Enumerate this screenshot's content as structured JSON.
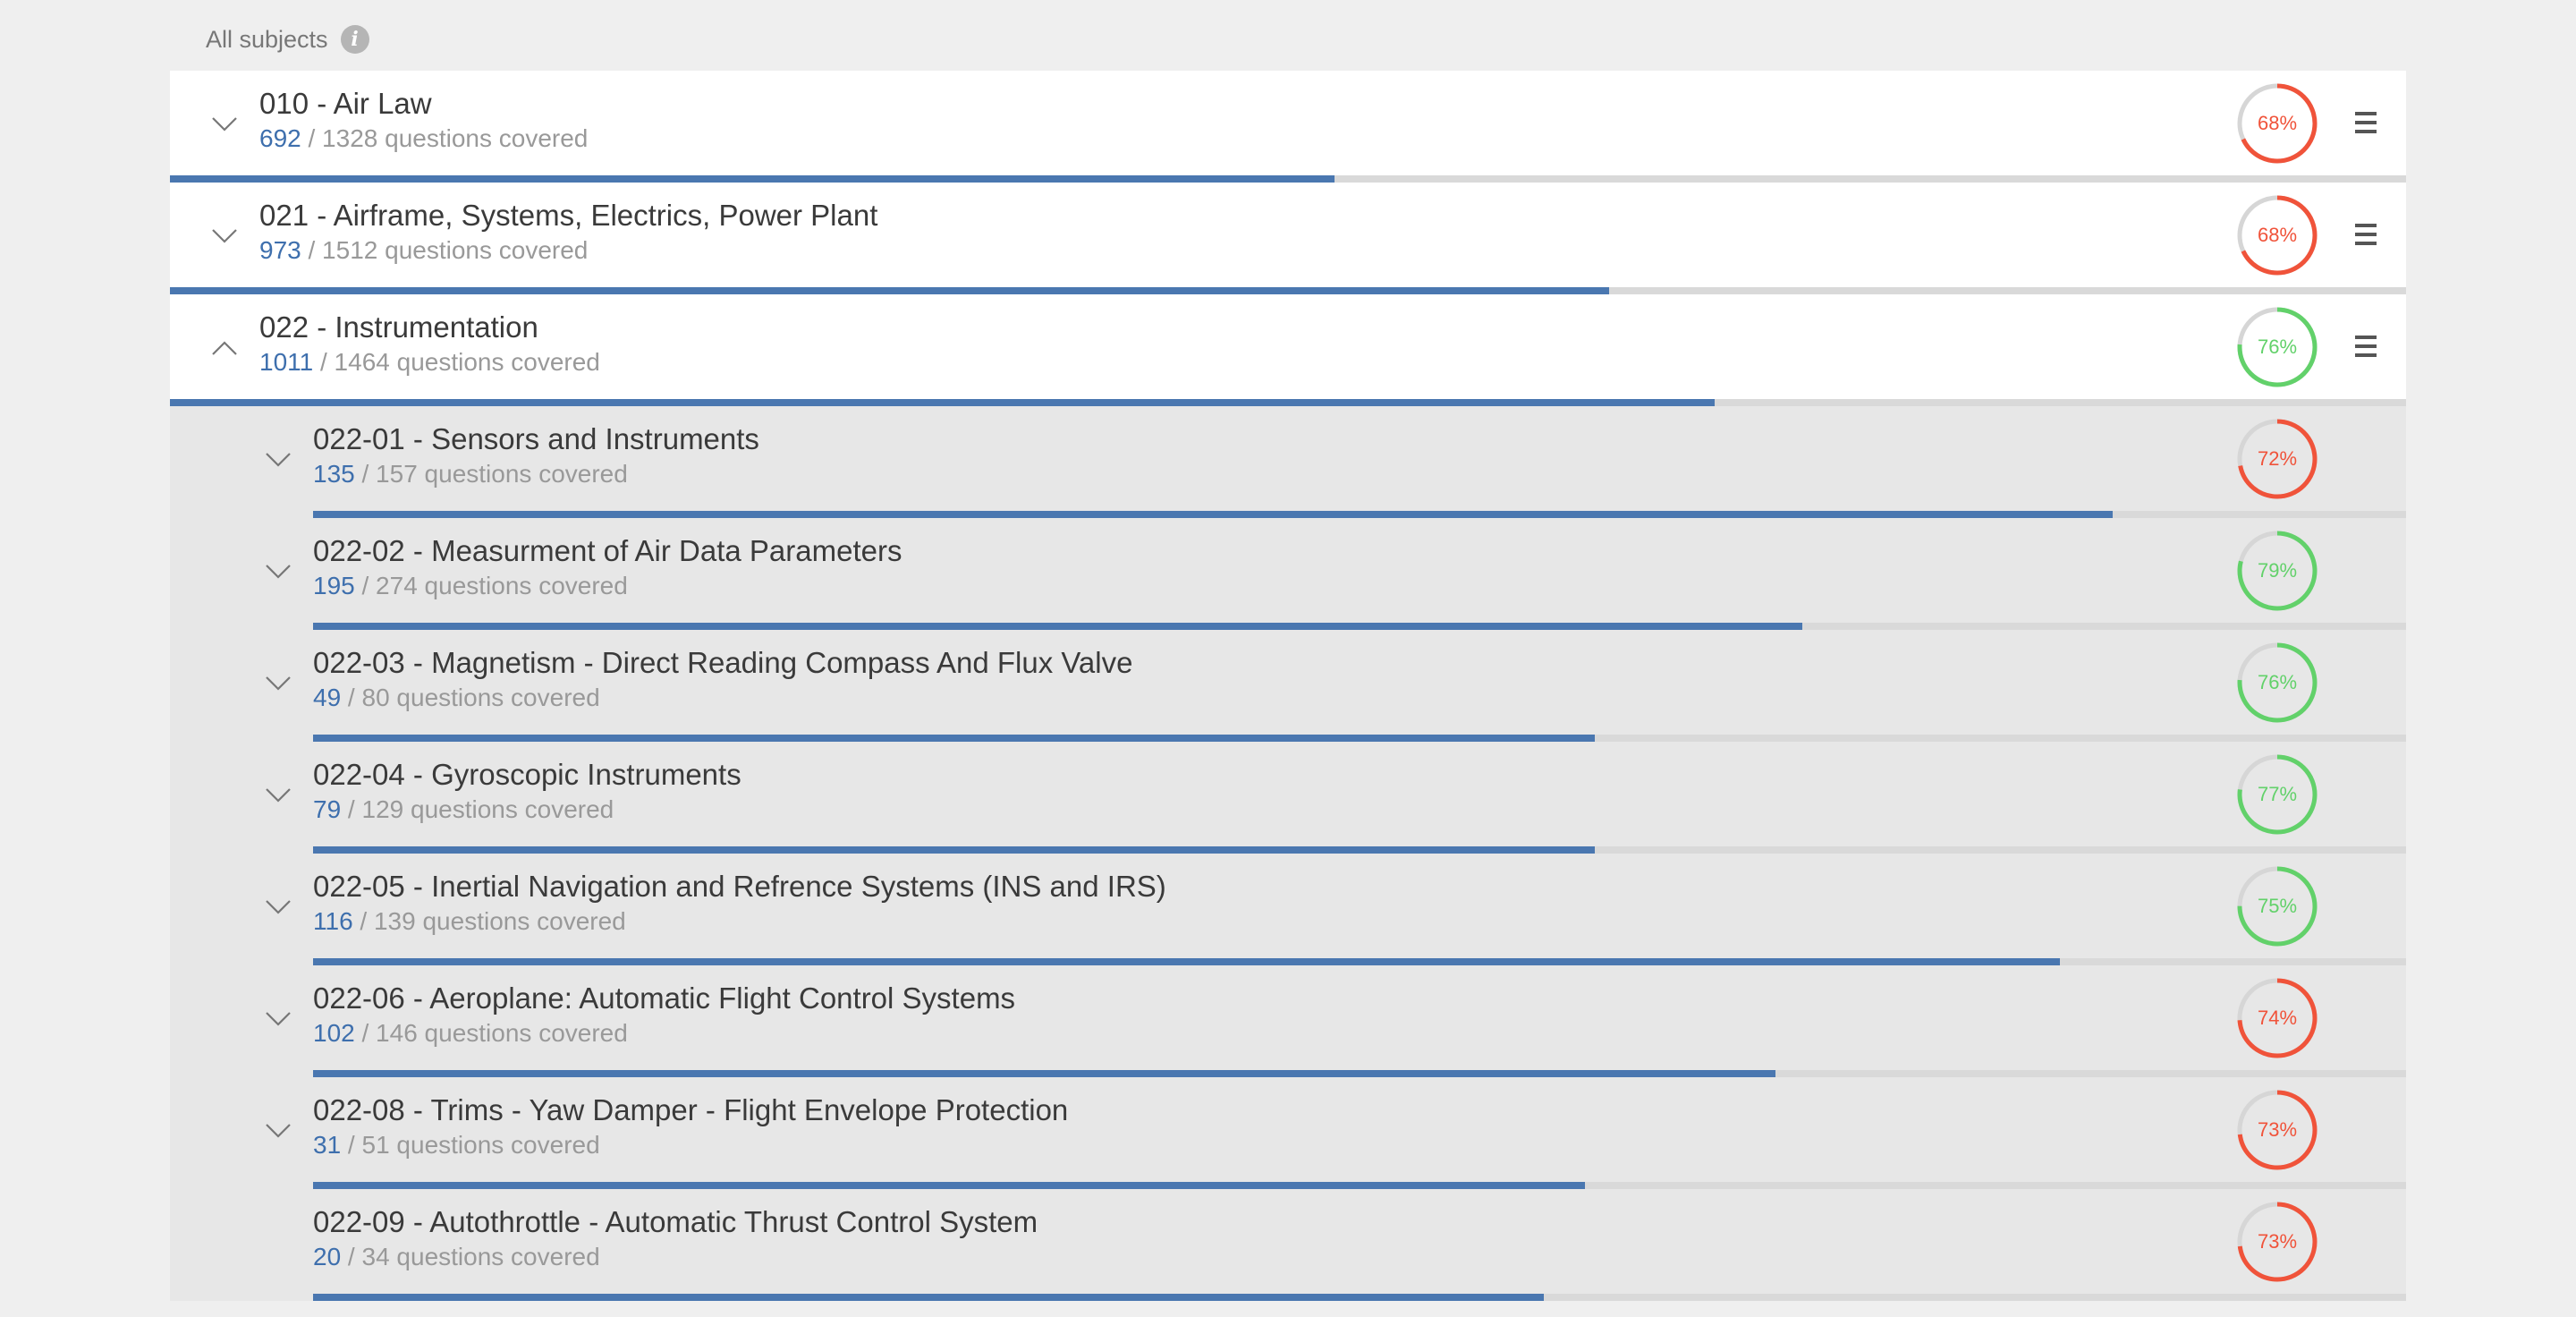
{
  "header": {
    "label": "All subjects"
  },
  "colors": {
    "good": "#62d16a",
    "bad": "#f0533a",
    "ring_track": "#d6d6d6",
    "covered": "#3e6fad",
    "bar": "#4a77b0"
  },
  "subjects": [
    {
      "title": "010 - Air Law",
      "covered": "692",
      "rest": " / 1328 questions covered",
      "score": "68%",
      "score_value": 68,
      "status": "bad",
      "progress": 0.5207,
      "expanded": false
    },
    {
      "title": "021 - Airframe, Systems, Electrics, Power Plant",
      "covered": "973",
      "rest": " / 1512 questions covered",
      "score": "68%",
      "score_value": 68,
      "status": "bad",
      "progress": 0.6435,
      "expanded": false
    },
    {
      "title": "022 - Instrumentation",
      "covered": "1011",
      "rest": " / 1464 questions covered",
      "score": "76%",
      "score_value": 76,
      "status": "good",
      "progress": 0.6906,
      "expanded": true
    }
  ],
  "topics": [
    {
      "title": "022-01 - Sensors and Instruments",
      "covered": "135",
      "rest": " / 157 questions covered",
      "score": "72%",
      "score_value": 72,
      "status": "bad",
      "progress": 0.8599,
      "chevron": true
    },
    {
      "title": "022-02 - Measurment of Air Data Parameters",
      "covered": "195",
      "rest": " / 274 questions covered",
      "score": "79%",
      "score_value": 79,
      "status": "good",
      "progress": 0.7117,
      "chevron": true
    },
    {
      "title": "022-03 - Magnetism - Direct Reading Compass And Flux Valve",
      "covered": "49",
      "rest": " / 80 questions covered",
      "score": "76%",
      "score_value": 76,
      "status": "good",
      "progress": 0.6125,
      "chevron": true
    },
    {
      "title": "022-04 - Gyroscopic Instruments",
      "covered": "79",
      "rest": " / 129 questions covered",
      "score": "77%",
      "score_value": 77,
      "status": "good",
      "progress": 0.6124,
      "chevron": true
    },
    {
      "title": "022-05 - Inertial Navigation and Refrence Systems (INS and IRS)",
      "covered": "116",
      "rest": " / 139 questions covered",
      "score": "75%",
      "score_value": 75,
      "status": "good",
      "progress": 0.8345,
      "chevron": true
    },
    {
      "title": "022-06 - Aeroplane: Automatic Flight Control Systems",
      "covered": "102",
      "rest": " / 146 questions covered",
      "score": "74%",
      "score_value": 74,
      "status": "bad",
      "progress": 0.6986,
      "chevron": true
    },
    {
      "title": "022-08 - Trims - Yaw Damper - Flight Envelope Protection",
      "covered": "31",
      "rest": " / 51 questions covered",
      "score": "73%",
      "score_value": 73,
      "status": "bad",
      "progress": 0.6078,
      "chevron": true
    },
    {
      "title": "022-09 - Autothrottle - Automatic Thrust Control System",
      "covered": "20",
      "rest": " / 34 questions covered",
      "score": "73%",
      "score_value": 73,
      "status": "bad",
      "progress": 0.5882,
      "chevron": false
    }
  ]
}
